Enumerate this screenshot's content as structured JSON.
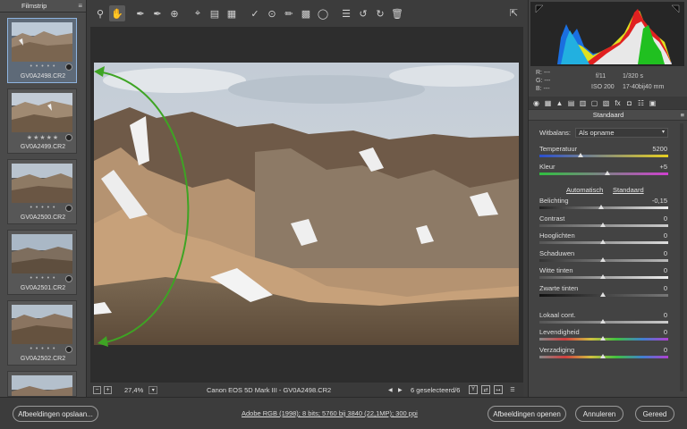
{
  "filmstrip": {
    "title": "Filmstrip",
    "items": [
      {
        "name": "GV0A2498.CR2",
        "rating": "• • • • •",
        "selected": true
      },
      {
        "name": "GV0A2499.CR2",
        "rating": "★★★★★",
        "selected": false
      },
      {
        "name": "GV0A2500.CR2",
        "rating": "• • • • •",
        "selected": false
      },
      {
        "name": "GV0A2501.CR2",
        "rating": "• • • • •",
        "selected": false
      },
      {
        "name": "GV0A2502.CR2",
        "rating": "• • • • •",
        "selected": false
      },
      {
        "name": "",
        "rating": "",
        "selected": false
      }
    ]
  },
  "toolbar": {
    "tools": [
      "zoom-icon",
      "hand-icon",
      "white-balance-icon",
      "color-sampler-icon",
      "target-adjust-icon",
      "crop-icon",
      "straighten-icon",
      "transform-icon",
      "spot-removal-icon",
      "red-eye-icon",
      "adjustment-brush-icon",
      "graduated-filter-icon",
      "radial-filter-icon",
      "preferences-icon",
      "rotate-left-icon",
      "rotate-right-icon",
      "trash-icon"
    ]
  },
  "status": {
    "zoom": "27,4%",
    "camera": "Canon EOS 5D Mark III  -  GV0A2498.CR2",
    "selected": "6 geselecteerd/6"
  },
  "meta": {
    "r": "R:   ---",
    "g": "G:   ---",
    "b": "B:   ---",
    "aperture": "f/11",
    "shutter": "1/320 s",
    "iso": "ISO 200",
    "lens": "17-40bij40 mm"
  },
  "panel": {
    "section": "Standaard",
    "wb_label": "Witbalans:",
    "wb_value": "Als opname",
    "auto_link": "Automatisch",
    "default_link": "Standaard",
    "sliders": [
      {
        "label": "Temperatuur",
        "value": "5200"
      },
      {
        "label": "Kleur",
        "value": "+5"
      },
      {
        "label": "Belichting",
        "value": "-0,15"
      },
      {
        "label": "Contrast",
        "value": "0"
      },
      {
        "label": "Hooglichten",
        "value": "0"
      },
      {
        "label": "Schaduwen",
        "value": "0"
      },
      {
        "label": "Witte tinten",
        "value": "0"
      },
      {
        "label": "Zwarte tinten",
        "value": "0"
      },
      {
        "label": "Lokaal cont.",
        "value": "0"
      },
      {
        "label": "Levendigheid",
        "value": "0"
      },
      {
        "label": "Verzadiging",
        "value": "0"
      }
    ]
  },
  "bottom": {
    "save": "Afbeeldingen opslaan...",
    "color_info": "Adobe RGB (1998); 8 bits; 5760 bij 3840 (22,1MP); 300 ppi",
    "open": "Afbeeldingen openen",
    "cancel": "Annuleren",
    "done": "Gereed"
  }
}
